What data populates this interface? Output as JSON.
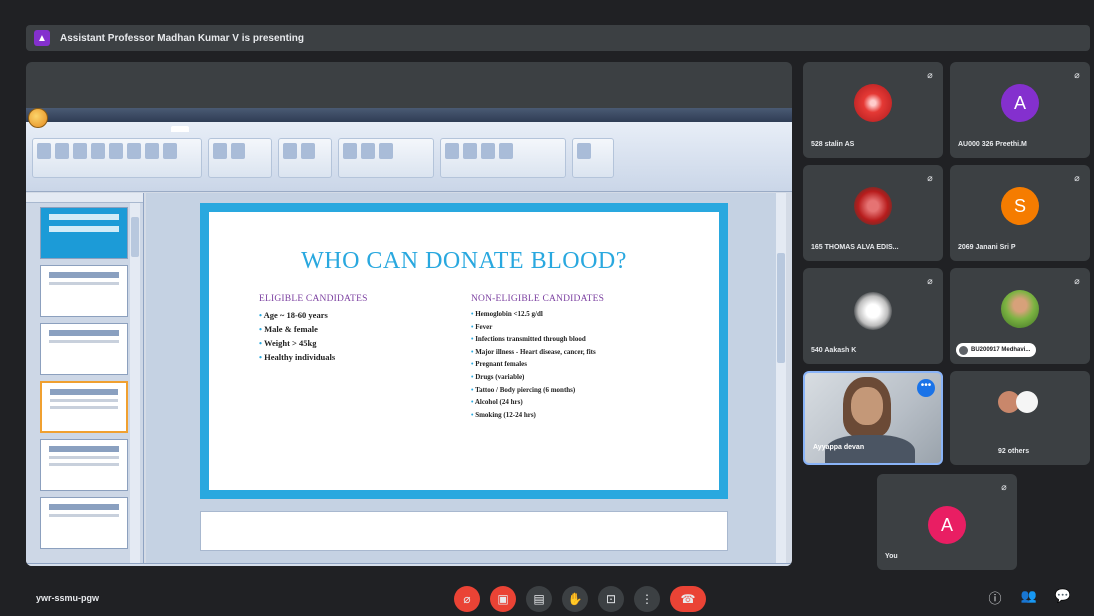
{
  "banner": {
    "text": "Assistant Professor Madhan Kumar V is presenting"
  },
  "slide": {
    "title": "WHO CAN DONATE BLOOD?",
    "left_heading": "ELIGIBLE CANDIDATES",
    "left_items": [
      "Age ~ 18-60 years",
      "Male & female",
      "Weight > 45kg",
      "Healthy individuals"
    ],
    "right_heading": "NON-ELIGIBLE CANDIDATES",
    "right_items": [
      "Hemoglobin <12.5 g/dl",
      "Fever",
      "Infections transmitted through blood",
      "Major illness - Heart disease, cancer, fits",
      "Pregnant females",
      "Drugs (variable)",
      "Tattoo / Body piercing (6 months)",
      "Alcohol (24 hrs)",
      "Smoking (12-24 hrs)"
    ]
  },
  "participants": [
    {
      "name": "528 stalin AS"
    },
    {
      "name": "AU000 326 Preethi.M",
      "initial": "A"
    },
    {
      "name": "165 THOMAS ALVA EDIS..."
    },
    {
      "name": "2069 Janani Sri P",
      "initial": "S"
    },
    {
      "name": "540 Aakash K"
    },
    {
      "name": "BU200917 Medhavi..."
    },
    {
      "name": "Ayyappa devan"
    },
    {
      "name": "92 others"
    },
    {
      "name": "You",
      "initial": "A"
    }
  ],
  "meeting_code": "ywr-ssmu-pgw",
  "colors": {
    "accent": "#1a73e8",
    "danger": "#ea4335",
    "slide_blue": "#29a8df",
    "purple": "#8430ce"
  }
}
